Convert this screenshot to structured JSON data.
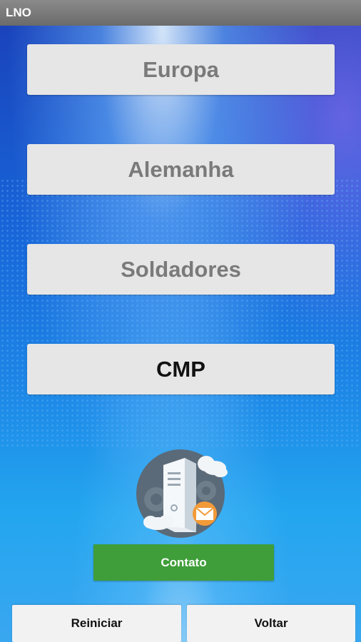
{
  "app": {
    "title": "LNO"
  },
  "menu": {
    "items": [
      {
        "label": "Europa",
        "selected": false
      },
      {
        "label": "Alemanha",
        "selected": false
      },
      {
        "label": "Soldadores",
        "selected": false
      },
      {
        "label": "CMP",
        "selected": true
      }
    ]
  },
  "contact": {
    "icon": "server-cloud-mail-icon",
    "label": "Contato",
    "color": "#3f9e3a"
  },
  "footer": {
    "restart_label": "Reiniciar",
    "back_label": "Voltar"
  },
  "colors": {
    "button_bg": "#e6e6e6",
    "button_text_inactive": "#7a7a7a",
    "button_text_active": "#111111"
  }
}
